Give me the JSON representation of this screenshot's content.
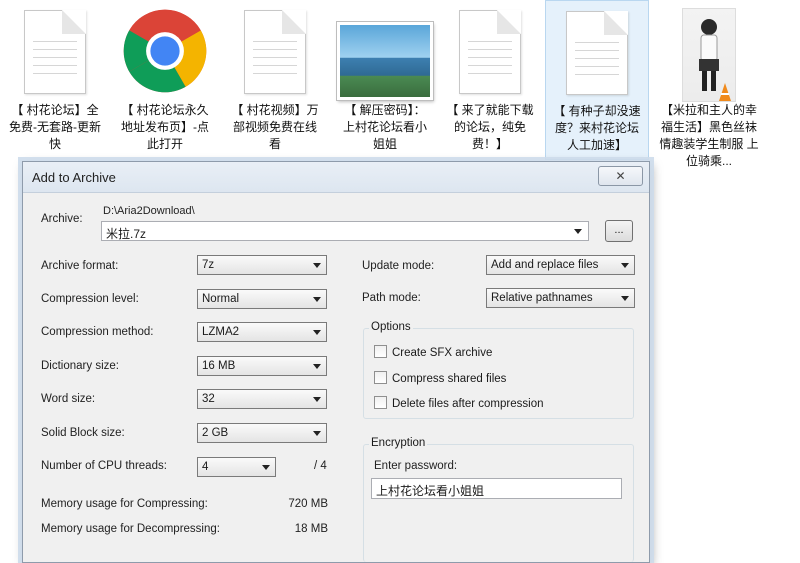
{
  "desktop": {
    "files": [
      {
        "caption": "【 村花论坛】全免费-无套路-更新快"
      },
      {
        "caption": "【 村花论坛永久地址发布页】-点此打开"
      },
      {
        "caption": "【 村花视频】万部视频免费在线看"
      },
      {
        "caption": "【 解压密码】：上村花论坛看小姐姐"
      },
      {
        "caption": "【 来了就能下载的论坛，纯免费！】"
      },
      {
        "caption": "【 有种子却没速度？来村花论坛人工加速】"
      },
      {
        "caption": "【米拉和主人的幸福生活】黑色丝袜情趣装学生制服 上位骑乘..."
      }
    ]
  },
  "dialog": {
    "title": "Add to Archive",
    "close_label": "✕",
    "archive": {
      "label": "Archive:",
      "path": "D:\\Aria2Download\\",
      "name": "米拉.7z",
      "browse_label": "..."
    },
    "left": {
      "archive_format": {
        "label": "Archive format:",
        "value": "7z"
      },
      "compression_level": {
        "label": "Compression level:",
        "value": "Normal"
      },
      "compression_method": {
        "label": "Compression method:",
        "value": "LZMA2"
      },
      "dictionary_size": {
        "label": "Dictionary size:",
        "value": "16 MB"
      },
      "word_size": {
        "label": "Word size:",
        "value": "32"
      },
      "solid_block_size": {
        "label": "Solid Block size:",
        "value": "2 GB"
      },
      "cpu_threads": {
        "label": "Number of CPU threads:",
        "value": "4",
        "max": "/ 4"
      },
      "mem_compress": {
        "label": "Memory usage for Compressing:",
        "value": "720 MB"
      },
      "mem_decompress": {
        "label": "Memory usage for Decompressing:",
        "value": "18 MB"
      }
    },
    "right": {
      "update_mode": {
        "label": "Update mode:",
        "value": "Add and replace files"
      },
      "path_mode": {
        "label": "Path mode:",
        "value": "Relative pathnames"
      },
      "options": {
        "title": "Options",
        "create_sfx": "Create SFX archive",
        "compress_shared": "Compress shared files",
        "delete_after": "Delete files after compression"
      },
      "encryption": {
        "title": "Encryption",
        "password_label": "Enter password:",
        "password_value": "上村花论坛看小姐姐"
      }
    }
  }
}
